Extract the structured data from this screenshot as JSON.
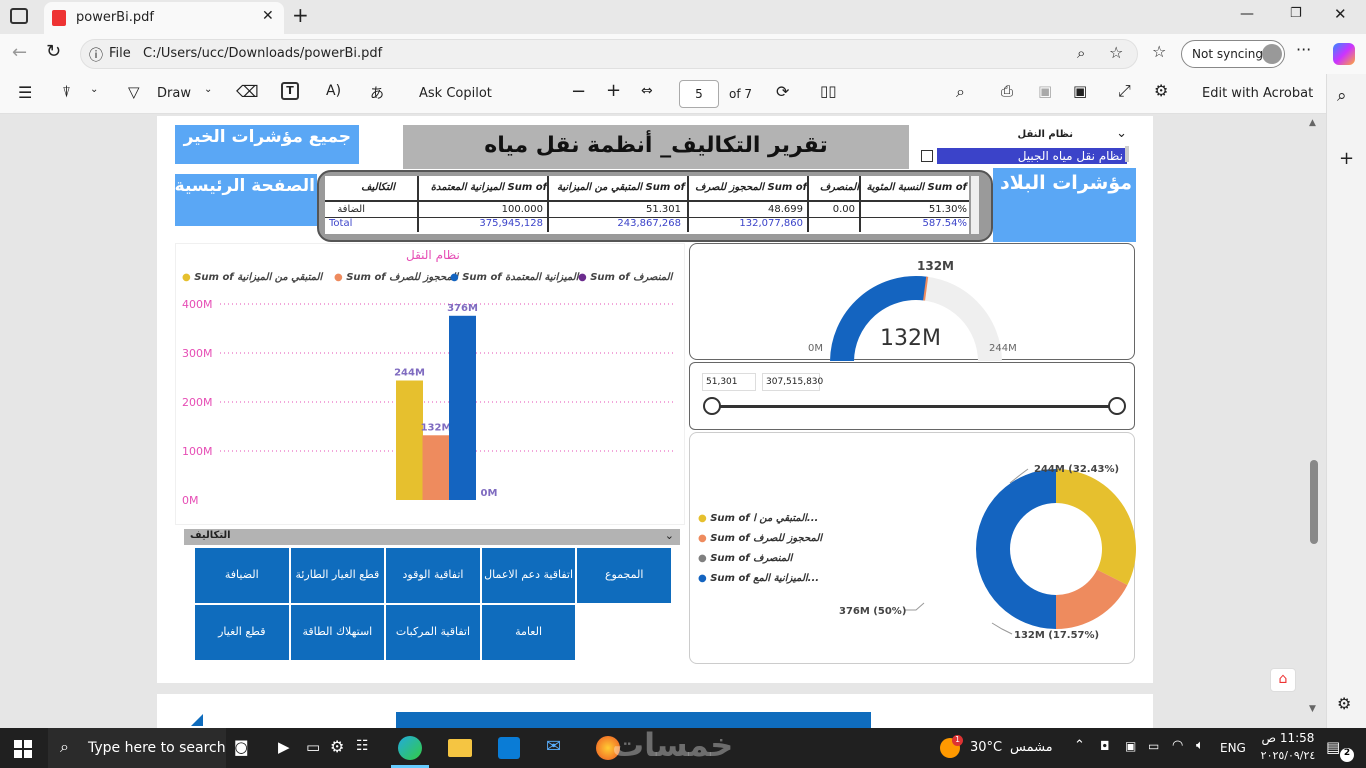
{
  "browser": {
    "tab_title": "powerBi.pdf",
    "file_label": "File",
    "url": "C:/Users/ucc/Downloads/powerBi.pdf",
    "sync_label": "Not syncing"
  },
  "pdf_toolbar": {
    "draw_label": "Draw",
    "copilot_label": "Ask Copilot",
    "page_number": "5",
    "page_total": "of 7",
    "edit_label": "Edit with Acrobat"
  },
  "report": {
    "btn_all_indicators": "جميع مؤشرات الخير",
    "btn_home": "الصفحة الرئيسية",
    "title": "تقرير التكاليف_ أنظمة نقل مياه",
    "btn_country": "مؤشرات البلاد",
    "slicer": {
      "label": "نظام النقل",
      "option": "نظام نقل مياه الجبيل"
    },
    "table": {
      "headers": [
        "النسبة المئوية Sum of",
        "المنصرف",
        "المحجوز للصرف Sum of",
        "المتبقي من الميزانية Sum of",
        "الميزانية المعتمدة Sum of",
        "التكاليف"
      ],
      "row": [
        "51.30%",
        "0.00",
        "48.699",
        "51.301",
        "100.000",
        "الضافة"
      ],
      "total": [
        "587.54%",
        "",
        "132,077,860",
        "243,867,268",
        "375,945,128",
        "Total"
      ]
    },
    "bar_chart_title": "نظام النقل",
    "gauge": {
      "min_label": "0M",
      "max_label": "244M",
      "top_label": "132M",
      "center_label": "132M"
    },
    "range_slider": {
      "min": "51,301",
      "max": "307,515,830"
    },
    "category_header": "التكاليف",
    "category_buttons": [
      [
        "المجموع",
        "اتفاقية دعم الاعمال",
        "اتفاقية الوقود",
        "قطع الغيار الطارئة",
        "الضيافة"
      ],
      [
        "",
        "العامة",
        "اتفاقية المركبات",
        "استهلاك الطاقة",
        "قطع الغيار"
      ]
    ],
    "donut_labels": {
      "a": "244M (32.43%)",
      "b": "132M (17.57%)",
      "c": "376M (50%)"
    },
    "donut_legend": [
      "Sum of المتبقي من ا...",
      "Sum of المحجوز للصرف",
      "Sum of المنصرف",
      "Sum of الميزانية المع..."
    ]
  },
  "chart_data": [
    {
      "type": "bar",
      "title": "نظام النقل",
      "categories": [
        ""
      ],
      "series": [
        {
          "name": "Sum of المتبقي من الميزانية",
          "color": "#e6c02e",
          "values": [
            243867268
          ]
        },
        {
          "name": "Sum of المحجوز للصرف",
          "color": "#ee8b5e",
          "values": [
            132077860
          ]
        },
        {
          "name": "Sum of الميزانية المعتمدة",
          "color": "#1464c0",
          "values": [
            375945128
          ]
        },
        {
          "name": "Sum of المنصرف",
          "color": "#6b2c8e",
          "values": [
            0
          ]
        }
      ],
      "data_labels": [
        "244M",
        "132M",
        "376M",
        "0M"
      ],
      "ytick_labels": [
        "0M",
        "100M",
        "200M",
        "300M",
        "400M"
      ],
      "ylim": [
        0,
        400000000
      ],
      "legend_position": "top"
    },
    {
      "type": "pie",
      "title": "",
      "slices": [
        {
          "name": "Sum of المتبقي من ا...",
          "value": 243867268,
          "percent": 32.43,
          "color": "#e6c02e"
        },
        {
          "name": "Sum of المحجوز للصرف",
          "value": 132077860,
          "percent": 17.57,
          "color": "#ee8b5e"
        },
        {
          "name": "Sum of المنصرف",
          "value": 0,
          "percent": 0,
          "color": "#808080"
        },
        {
          "name": "Sum of الميزانية المع...",
          "value": 375945128,
          "percent": 50,
          "color": "#1464c0"
        }
      ],
      "legend_position": "left"
    },
    {
      "type": "gauge",
      "value": 132077860,
      "min": 0,
      "max": 243867268
    }
  ],
  "taskbar": {
    "search_placeholder": "Type here to search",
    "weather": "30°C",
    "weather_text": "مشمس",
    "weather_badge": "1",
    "lang": "ENG",
    "time": "11:58 ص",
    "date": "٢٠٢٥/٠٩/٢٤",
    "notif_count": "2",
    "watermark": "خمسات"
  }
}
